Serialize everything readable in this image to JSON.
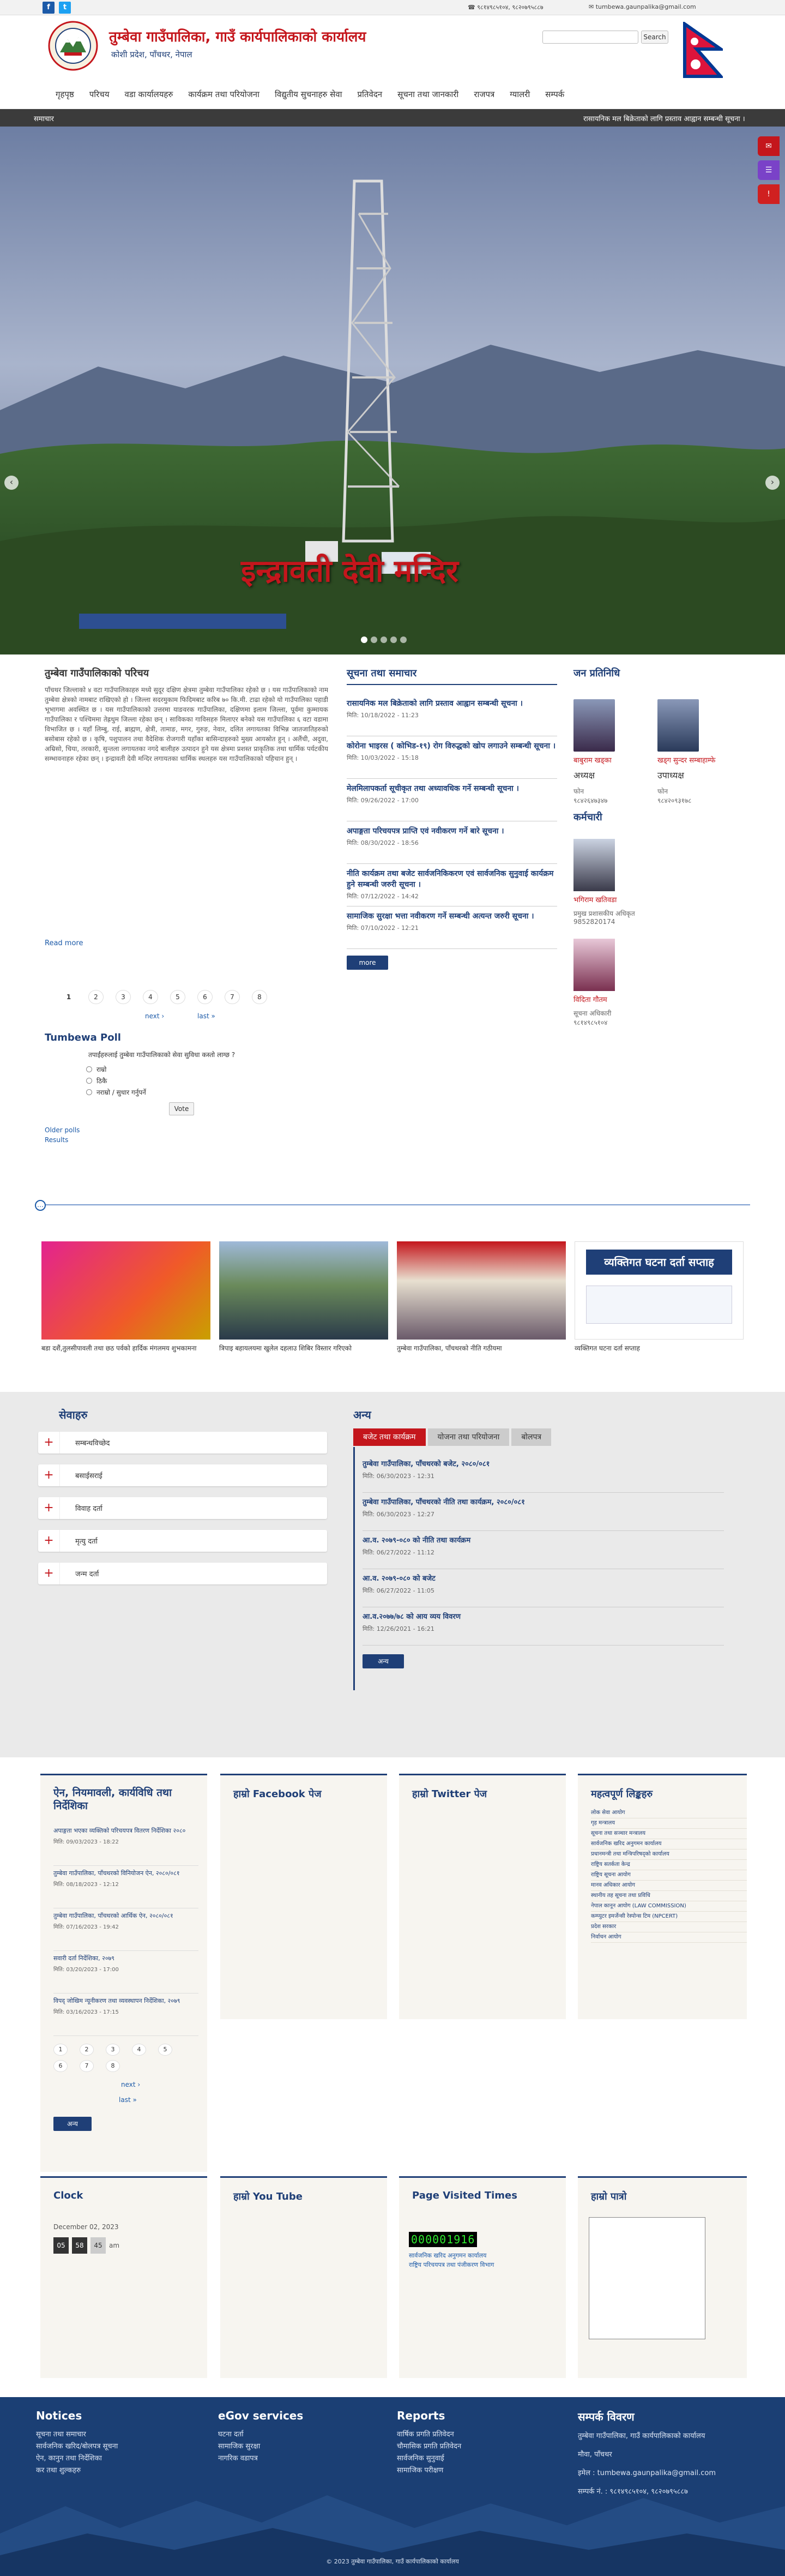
{
  "topbar": {
    "phone": "९८१४९८५१०४, ९८२०७९५८८७",
    "email": "tumbewa.gaunpalika@gmail.com"
  },
  "header": {
    "title": "तुम्बेवा गाउँपालिका, गाउँ कार्यपालिकाको कार्यालय",
    "subtitle": "कोशी प्रदेश, पाँचथर, नेपाल",
    "search_placeholder": "",
    "search_button": "Search"
  },
  "nav": [
    "गृहपृष्ठ",
    "परिचय",
    "वडा कार्यालयहरु",
    "कार्यक्रम तथा परियोजना",
    "विद्युतीय सुचनाहरु सेवा",
    "प्रतिवेदन",
    "सूचना तथा जानकारी",
    "राजपत्र",
    "ग्यालरी",
    "सम्पर्क"
  ],
  "ticker": {
    "label": "समाचार",
    "text": "रासायनिक मल बिक्रेताको लागि प्रस्ताव आह्वान सम्बन्धी सूचना ।"
  },
  "hero": {
    "caption": "इन्द्रावती देवी मन्दिर",
    "dots": 5
  },
  "intro": {
    "title": "तुम्बेवा गाउँपालिकाको परिचय",
    "body": "पाँचथर जिल्लाको ४ वटा गाउँपालिकाहरु मध्ये सुदूर दक्षिण क्षेत्रमा तुम्बेवा गाउँपालिका रहेको छ । यस गाउँपालिकाको नाम तुम्बेवा क्षेत्रको नामबाट राखिएको हो । जिल्ला सदरमुकाम फिदिमबाट करिब ७० कि.मी. टाढा रहेको यो गाउँपालिका पहाडी भूभागमा अवस्थित छ । यस गाउँपालिकाको उत्तरमा याङवरक गाउँपालिका, दक्षिणमा इलाम जिल्ला, पूर्वमा कुम्मायक गाउँपालिका र पश्चिममा तेह्रथुम जिल्ला रहेका छन् । साविकका गाविसहरु मिलाएर बनेको यस गाउँपालिका ६ वटा वडामा विभाजित छ । यहाँ लिम्बु, राई, ब्राह्मण, क्षेत्री, तामाङ, मगर, गुरुङ, नेवार, दलित लगायतका विभिन्न जातजातिहरुको बसोबास रहेको छ । कृषि, पशुपालन तथा वैदेशिक रोजगारी यहाँका बासिन्दाहरुको मुख्य आयस्रोत हुन् । अलैंची, अदुवा, अम्रिसो, चिया, तरकारी, सुन्तला लगायतका नगदे बालीहरु उत्पादन हुने यस क्षेत्रमा प्रशस्त प्राकृतिक तथा धार्मिक पर्यटकीय सम्भावनाहरु रहेका छन् । इन्द्रावती देवी मन्दिर लगायतका धार्मिक स्थलहरु यस गाउँपालिकाको पहिचान हुन् ।",
    "read_more": "Read more"
  },
  "pager1": [
    "1",
    "2",
    "3",
    "4",
    "5",
    "6",
    "7",
    "8"
  ],
  "pager1_next": "next ›",
  "pager1_last": "last »",
  "poll": {
    "title": "Tumbewa Poll",
    "question": "तपाईंहरुलाई तुम्बेवा गाउँपालिकाको सेवा सुविधा कस्तो लाग्छ ?",
    "options": [
      "राम्रो",
      "ठिकै",
      "नराम्रो / सुधार गर्नुपर्ने"
    ],
    "vote": "Vote",
    "older": "Older polls",
    "results": "Results"
  },
  "notices": {
    "title": "सूचना तथा समाचार",
    "items": [
      {
        "title": "रासायनिक मल बिक्रेताको लागि प्रस्ताव आह्वान सम्बन्धी सूचना ।",
        "date": "मिति: 10/18/2022 - 11:23"
      },
      {
        "title": "कोरोना भाइरस ( कोभिड-१९) रोग विरुद्धको खोप लगाउने सम्बन्धी सूचना ।",
        "date": "मिति: 10/03/2022 - 15:18"
      },
      {
        "title": "मेलमिलापकर्ता सूचीकृत तथा अध्यावधिक गर्ने सम्बन्धी सूचना ।",
        "date": "मिति: 09/26/2022 - 17:00"
      },
      {
        "title": "अपाङ्गता परिचयपत्र प्राप्ति एवं नवीकरण गर्ने बारे सूचना ।",
        "date": "मिति: 08/30/2022 - 18:56"
      },
      {
        "title": "नीति कार्यक्रम तथा बजेट सार्वजनिकिकरण एवं सार्वजनिक सुनुवाई कार्यक्रम हुने सम्बन्धी जरुरी सूचना ।",
        "date": "मिति: 07/12/2022 - 14:42"
      },
      {
        "title": "सामाजिक सुरक्षा भत्ता नवीकरण गर्ने सम्बन्धी अत्यन्त जरुरी सूचना ।",
        "date": "मिति: 07/10/2022 - 12:21"
      }
    ],
    "more": "more"
  },
  "reps": {
    "title": "जन प्रतिनिधि",
    "people": [
      {
        "name": "बाबुराम खड्का",
        "role": "अध्यक्ष",
        "phone_label": "फोन",
        "phone": "९८४२६४७३४७"
      },
      {
        "name": "खड्ग सुन्दर सम्बाहाम्फे",
        "role": "उपाध्यक्ष",
        "phone_label": "फोन",
        "phone": "९८४२०९३१७८"
      }
    ],
    "staff_title": "कर्मचारी",
    "staff": [
      {
        "name": "भगिराम खतिवडा",
        "role": "प्रमुख प्रशासकीय अधिकृत",
        "phone": "9852820174"
      },
      {
        "name": "विदिता गौतम",
        "role": "सूचना अधिकारी",
        "phone": "९८१४९८५१०४"
      }
    ]
  },
  "gallery": [
    {
      "caption": "बडा दशैं,तुलसीपावली तथा छठ पर्वको हार्दिक मंगलमय शुभकामना"
    },
    {
      "caption": "त्रिपाइ बहायलयमा खुलेल दहलाउ शिबिर विस्तार गरिएको"
    },
    {
      "caption": "तुम्बेवा गाउँपालिका, पाँचथरको नीति गठीयमा"
    },
    {
      "caption": "व्यक्तिगत घटना दर्ता सप्ताह"
    }
  ],
  "gallery_banner": "व्यक्तिगत घटना दर्ता सप्ताह",
  "services": {
    "title": "सेवाहरु",
    "items": [
      "सम्बन्धविच्छेद",
      "बसाईसराई",
      "विवाह दर्ता",
      "मृत्यु दर्ता",
      "जन्म दर्ता"
    ]
  },
  "others": {
    "title": "अन्य",
    "tabs": [
      "बजेट तथा कार्यक्रम",
      "योजना तथा परियोजना",
      "बोलपत्र"
    ],
    "items": [
      {
        "title": "तुम्बेवा गाउँपालिका, पाँचथरको बजेट, २०८०/०८१",
        "date": "मिति: 06/30/2023 - 12:31"
      },
      {
        "title": "तुम्बेवा गाउँपालिका, पाँचथरको नीति तथा कार्यक्रम, २०८०/०८१",
        "date": "मिति: 06/30/2023 - 12:27"
      },
      {
        "title": "आ.व. २०७९-०८० को नीति तथा कार्यक्रम",
        "date": "मिति: 06/27/2022 - 11:12"
      },
      {
        "title": "आ.व. २०७९-०८० को बजेट",
        "date": "मिति: 06/27/2022 - 11:05"
      },
      {
        "title": "आ.व.२०७७/७८ को आय व्यय विवरण",
        "date": "मिति: 12/26/2021 - 16:21"
      }
    ],
    "more": "अन्य"
  },
  "laws": {
    "title": "ऐन, नियमावली, कार्यविधि तथा निर्देशिका",
    "items": [
      {
        "title": "अपाङ्गता भएका व्यक्तिको परिचयपत्र वितरण निर्देशिका २०८०",
        "date": "मिति: 09/03/2023 - 18:22"
      },
      {
        "title": "तुम्बेवा गाउँपालिका, पाँचथरको विनियोजन ऐन, २०८०/०८१",
        "date": "मिति: 08/18/2023 - 12:12"
      },
      {
        "title": "तुम्बेवा गाउँपालिका, पाँचथरको आर्थिक ऐन, २०८०/०८१",
        "date": "मिति: 07/16/2023 - 19:42"
      },
      {
        "title": "सवारी दर्ता निर्देशिका, २०७९",
        "date": "मिति: 03/20/2023 - 17:00"
      },
      {
        "title": "विपद् जोखिम न्यूनीकरण तथा व्यवस्थापन निर्देशिका, २०७९",
        "date": "मिति: 03/16/2023 - 17:15"
      }
    ],
    "pager": [
      "1",
      "2",
      "3",
      "4",
      "5",
      "6",
      "7",
      "8"
    ],
    "next": "next ›",
    "last": "last »",
    "more": "अन्य"
  },
  "facebook": {
    "title": "हाम्रो Facebook पेज"
  },
  "twitter": {
    "title": "हाम्रो Twitter पेज"
  },
  "links": {
    "title": "महत्वपूर्ण लिङ्कहरु",
    "items": [
      "लोक सेवा आयोग",
      "गृह मन्त्रालय",
      "सूचना तथा सञ्चार मन्त्रालय",
      "सार्वजनिक खरिद अनुगमन कार्यालय",
      "प्रधानमन्त्री तथा मन्त्रिपरिषद्को कार्यालय",
      "राष्ट्रिय सतर्कता केन्द्र",
      "राष्ट्रिय सूचना आयोग",
      "मानव अधिकार आयोग",
      "स्थानीय तह सूचना तथा प्रविधि",
      "नेपाल कानून आयोग (LAW COMMISSION)",
      "कम्प्युटर इमर्जेन्सी रेस्पोन्स टिम (NPCERT)",
      "प्रदेश सरकार",
      "निर्वाचन आयोग"
    ]
  },
  "clock": {
    "title": "Clock",
    "date": "December 02, 2023",
    "h": "05",
    "m": "58",
    "s": "45",
    "ampm": "am"
  },
  "youtube": {
    "title": "हाम्रो You Tube"
  },
  "visits": {
    "title": "Page Visited Times",
    "count": "000001916",
    "line1": "सार्वजनिक खरिद अनुगमन कार्यालय",
    "line2": "राष्ट्रिय परिचयपत्र तथा पंजीकरण विभाग"
  },
  "patro": {
    "title": "हाम्रो पात्रो"
  },
  "footer": {
    "cols": [
      {
        "title": "Notices",
        "items": [
          "सूचना तथा समाचार",
          "सार्वजनिक खरिद/बोलपत्र सूचना",
          "ऐन, कानुन तथा निर्देशिका",
          "कर तथा शुल्कहरु"
        ]
      },
      {
        "title": "eGov services",
        "items": [
          "घटना दर्ता",
          "सामाजिक सुरक्षा",
          "नागरिक वडापत्र"
        ]
      },
      {
        "title": "Reports",
        "items": [
          "वार्षिक प्रगति प्रतिवेदन",
          "चौमासिक प्रगति प्रतिवेदन",
          "सार्वजनिक सुनुवाई",
          "सामाजिक परीक्षण"
        ]
      }
    ],
    "contact_title": "सम्पर्क विवरण",
    "contact_org": "तुम्बेवा गाउँपालिका, गाउँ कार्यपालिकाको कार्यालय",
    "contact_addr": "मौवा, पाँचथर",
    "contact_email": "इमेल : tumbewa.gaunpalika@gmail.com",
    "contact_phone": "सम्पर्क नं. : ९८१४९८५१०४, ९८२०७९५८८७",
    "copyright": "© 2023 तुम्बेवा गाउँपालिका, गाउँ कार्यपालिकाको कार्यालय"
  },
  "colors": {
    "brand_blue": "#1f3f77",
    "brand_red": "#c4161c",
    "footer_blue": "#1b3f74"
  }
}
